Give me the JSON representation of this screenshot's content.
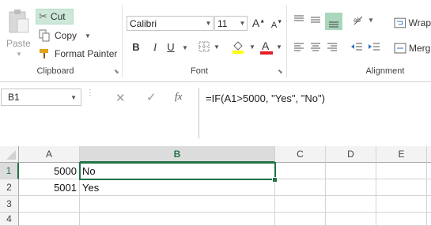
{
  "clipboard": {
    "paste_label": "Paste",
    "cut_label": "Cut",
    "copy_label": "Copy",
    "format_painter_label": "Format Painter",
    "group_label": "Clipboard"
  },
  "font": {
    "name": "Calibri",
    "size": "11",
    "group_label": "Font",
    "bold": "B",
    "italic": "I",
    "underline": "U",
    "grow": "A",
    "shrink": "A"
  },
  "alignment": {
    "wrap_label": "Wrap",
    "merge_label": "Merg",
    "group_label": "Alignment"
  },
  "formula_bar": {
    "name_box": "B1",
    "formula": "=IF(A1>5000, \"Yes\", \"No\")",
    "fx": "fx"
  },
  "sheet": {
    "columns": [
      "A",
      "B",
      "C",
      "D",
      "E"
    ],
    "rows": [
      {
        "num": "1",
        "a": "5000",
        "b": "No"
      },
      {
        "num": "2",
        "a": "5001",
        "b": "Yes"
      },
      {
        "num": "3",
        "a": "",
        "b": ""
      },
      {
        "num": "4",
        "a": "",
        "b": ""
      }
    ]
  },
  "colors": {
    "selected_header_text": "#217346",
    "selection_border": "#217346",
    "cut_highlight": "#cde8d8",
    "font_color_red": "#e51c23",
    "highlight_yellow": "#ffff00"
  }
}
